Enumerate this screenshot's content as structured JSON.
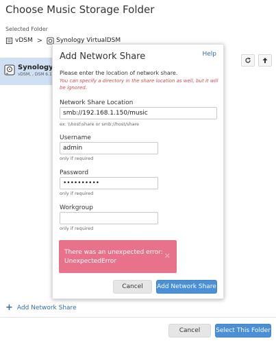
{
  "window": {
    "title": "Choose Music Storage Folder",
    "selected_folder_label": "Selected Folder",
    "breadcrumb": [
      "vDSM",
      "Synology VirtualDSM"
    ],
    "breadcrumb_separator": ">"
  },
  "toolbar": {
    "refresh_icon": "refresh-icon",
    "up_icon": "arrow-up-icon"
  },
  "file_list": {
    "items": [
      {
        "name": "Synology VirtualDSM",
        "subtitle": "vDSM, , DSM 6.1.4",
        "icon": "harddrive-icon"
      }
    ]
  },
  "footer": {
    "add_share": "Add Network Share",
    "cancel": "Cancel",
    "select": "Select This Folder"
  },
  "dialog": {
    "title": "Add Network Share",
    "help": "Help",
    "intro": "Please enter the location of network share.",
    "hint": "You can specify a directory in the share location as well, but it will be ignored.",
    "location_label": "Network Share Location",
    "location_value": "smb://192.168.1.150/music",
    "location_example": "ex: \\\\host\\share or smb://host/share",
    "username_label": "Username",
    "username_value": "admin",
    "username_note": "only if required",
    "password_label": "Password",
    "password_value": "••••••••••",
    "password_note": "only if required",
    "workgroup_label": "Workgroup",
    "workgroup_value": "",
    "workgroup_note": "only if required",
    "error_line1": "There was an unexpected error:",
    "error_line2": "UnexpectedError",
    "error_close": "×",
    "cancel": "Cancel",
    "submit": "Add Network Share"
  },
  "colors": {
    "accent": "#4a90d9",
    "link": "#2e6db4",
    "error_bg": "#e8728a",
    "hint_red": "#d44a57",
    "selected_row": "#cfe0f3"
  }
}
